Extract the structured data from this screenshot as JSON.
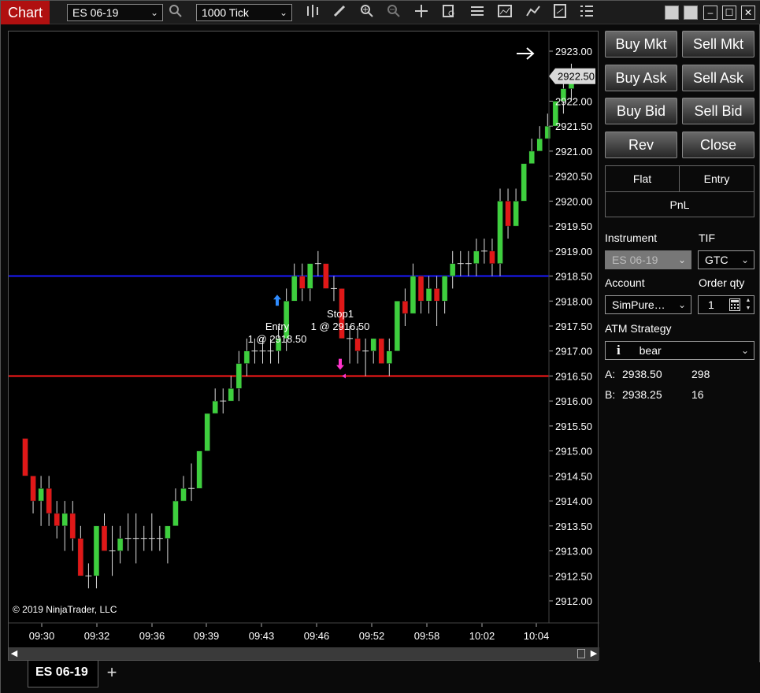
{
  "window": {
    "title": "Chart",
    "instrument_select": "ES 06-19",
    "interval_select": "1000 Tick"
  },
  "toolbar_icons": [
    "bar-type-icon",
    "pencil-icon",
    "zoom-in-icon",
    "zoom-out-icon",
    "crosshair-icon",
    "data-box-icon",
    "properties-icon",
    "indicators-icon",
    "strategies-icon",
    "templates-icon",
    "menu-icon"
  ],
  "chart": {
    "copyright": "© 2019 NinjaTrader, LLC",
    "current_price": "2922.50",
    "price_axis": [
      "2923.00",
      "2922.50",
      "2922.00",
      "2921.50",
      "2921.00",
      "2920.50",
      "2920.00",
      "2919.50",
      "2919.00",
      "2918.50",
      "2918.00",
      "2917.50",
      "2917.00",
      "2916.50",
      "2916.00",
      "2915.50",
      "2915.00",
      "2914.50",
      "2914.00",
      "2913.50",
      "2913.00",
      "2912.50",
      "2912.00"
    ],
    "time_axis": [
      "09:30",
      "09:32",
      "09:36",
      "09:39",
      "09:43",
      "09:46",
      "09:52",
      "09:58",
      "10:02",
      "10:04"
    ],
    "lines": {
      "blue": 2918.5,
      "red": 2916.5
    },
    "entry_label": "Entry",
    "entry_detail": "1 @ 2918.50",
    "stop_label": "Stop1",
    "stop_detail": "1 @ 2916.50",
    "colors": {
      "up": "#3ecf3e",
      "down": "#e01818",
      "blue_line": "#1a1aff",
      "red_line": "#ff1a1a"
    }
  },
  "chart_data": {
    "type": "candlestick",
    "ylim": [
      2911.75,
      2923.25
    ],
    "candles": [
      {
        "o": 2915.25,
        "c": 2914.5,
        "h": 2915.25,
        "l": 2914.5
      },
      {
        "o": 2914.5,
        "c": 2914.0,
        "h": 2914.5,
        "l": 2913.75
      },
      {
        "o": 2914.0,
        "c": 2914.25,
        "h": 2914.5,
        "l": 2913.5
      },
      {
        "o": 2914.25,
        "c": 2913.75,
        "h": 2914.5,
        "l": 2913.5
      },
      {
        "o": 2913.75,
        "c": 2913.5,
        "h": 2914.0,
        "l": 2913.25
      },
      {
        "o": 2913.5,
        "c": 2913.75,
        "h": 2914.0,
        "l": 2913.0
      },
      {
        "o": 2913.75,
        "c": 2913.25,
        "h": 2914.0,
        "l": 2913.0
      },
      {
        "o": 2913.25,
        "c": 2912.5,
        "h": 2913.5,
        "l": 2912.5
      },
      {
        "o": 2912.5,
        "c": 2912.5,
        "h": 2912.75,
        "l": 2912.25
      },
      {
        "o": 2912.5,
        "c": 2913.5,
        "h": 2913.5,
        "l": 2912.25
      },
      {
        "o": 2913.5,
        "c": 2913.0,
        "h": 2913.75,
        "l": 2913.0
      },
      {
        "o": 2913.0,
        "c": 2913.0,
        "h": 2913.5,
        "l": 2912.5
      },
      {
        "o": 2913.0,
        "c": 2913.25,
        "h": 2913.5,
        "l": 2912.75
      },
      {
        "o": 2913.25,
        "c": 2913.25,
        "h": 2913.75,
        "l": 2913.0
      },
      {
        "o": 2913.25,
        "c": 2913.25,
        "h": 2913.75,
        "l": 2912.75
      },
      {
        "o": 2913.25,
        "c": 2913.25,
        "h": 2913.5,
        "l": 2913.0
      },
      {
        "o": 2913.25,
        "c": 2913.25,
        "h": 2913.75,
        "l": 2913.0
      },
      {
        "o": 2913.25,
        "c": 2913.25,
        "h": 2913.5,
        "l": 2913.0
      },
      {
        "o": 2913.25,
        "c": 2913.5,
        "h": 2913.5,
        "l": 2912.75
      },
      {
        "o": 2913.5,
        "c": 2914.0,
        "h": 2914.25,
        "l": 2913.5
      },
      {
        "o": 2914.0,
        "c": 2914.25,
        "h": 2914.5,
        "l": 2914.0
      },
      {
        "o": 2914.25,
        "c": 2914.25,
        "h": 2914.75,
        "l": 2914.0
      },
      {
        "o": 2914.25,
        "c": 2915.0,
        "h": 2915.0,
        "l": 2914.25
      },
      {
        "o": 2915.0,
        "c": 2915.75,
        "h": 2915.75,
        "l": 2915.0
      },
      {
        "o": 2915.75,
        "c": 2916.0,
        "h": 2916.25,
        "l": 2915.75
      },
      {
        "o": 2916.0,
        "c": 2916.0,
        "h": 2916.25,
        "l": 2915.75
      },
      {
        "o": 2916.0,
        "c": 2916.25,
        "h": 2916.5,
        "l": 2916.0
      },
      {
        "o": 2916.25,
        "c": 2916.75,
        "h": 2917.0,
        "l": 2916.0
      },
      {
        "o": 2916.75,
        "c": 2917.0,
        "h": 2917.25,
        "l": 2916.5
      },
      {
        "o": 2917.0,
        "c": 2917.0,
        "h": 2917.25,
        "l": 2916.75
      },
      {
        "o": 2917.0,
        "c": 2917.0,
        "h": 2917.25,
        "l": 2916.75
      },
      {
        "o": 2917.0,
        "c": 2917.0,
        "h": 2917.25,
        "l": 2916.75
      },
      {
        "o": 2917.0,
        "c": 2917.25,
        "h": 2917.5,
        "l": 2916.75
      },
      {
        "o": 2917.25,
        "c": 2918.0,
        "h": 2918.25,
        "l": 2917.0
      },
      {
        "o": 2918.0,
        "c": 2918.5,
        "h": 2918.75,
        "l": 2918.0
      },
      {
        "o": 2918.5,
        "c": 2918.25,
        "h": 2918.75,
        "l": 2918.0
      },
      {
        "o": 2918.25,
        "c": 2918.75,
        "h": 2918.75,
        "l": 2918.0
      },
      {
        "o": 2918.75,
        "c": 2918.75,
        "h": 2919.0,
        "l": 2918.5
      },
      {
        "o": 2918.75,
        "c": 2918.25,
        "h": 2918.75,
        "l": 2918.25
      },
      {
        "o": 2918.25,
        "c": 2918.25,
        "h": 2918.5,
        "l": 2918.0
      },
      {
        "o": 2918.25,
        "c": 2917.25,
        "h": 2918.25,
        "l": 2917.25
      },
      {
        "o": 2917.25,
        "c": 2917.25,
        "h": 2917.5,
        "l": 2916.75
      },
      {
        "o": 2917.25,
        "c": 2917.0,
        "h": 2917.5,
        "l": 2916.75
      },
      {
        "o": 2917.0,
        "c": 2917.0,
        "h": 2917.25,
        "l": 2916.5
      },
      {
        "o": 2917.0,
        "c": 2917.25,
        "h": 2917.25,
        "l": 2916.75
      },
      {
        "o": 2917.25,
        "c": 2916.75,
        "h": 2917.25,
        "l": 2916.75
      },
      {
        "o": 2916.75,
        "c": 2917.0,
        "h": 2917.25,
        "l": 2916.5
      },
      {
        "o": 2917.0,
        "c": 2918.0,
        "h": 2918.0,
        "l": 2917.0
      },
      {
        "o": 2918.0,
        "c": 2917.75,
        "h": 2918.25,
        "l": 2917.5
      },
      {
        "o": 2917.75,
        "c": 2918.5,
        "h": 2918.75,
        "l": 2917.75
      },
      {
        "o": 2918.5,
        "c": 2918.0,
        "h": 2918.5,
        "l": 2917.75
      },
      {
        "o": 2918.0,
        "c": 2918.25,
        "h": 2918.5,
        "l": 2917.75
      },
      {
        "o": 2918.25,
        "c": 2918.0,
        "h": 2918.5,
        "l": 2917.5
      },
      {
        "o": 2918.0,
        "c": 2918.5,
        "h": 2918.5,
        "l": 2917.75
      },
      {
        "o": 2918.5,
        "c": 2918.75,
        "h": 2919.0,
        "l": 2918.25
      },
      {
        "o": 2918.75,
        "c": 2918.75,
        "h": 2919.0,
        "l": 2918.5
      },
      {
        "o": 2918.75,
        "c": 2918.75,
        "h": 2919.0,
        "l": 2918.5
      },
      {
        "o": 2918.75,
        "c": 2919.0,
        "h": 2919.25,
        "l": 2918.5
      },
      {
        "o": 2919.0,
        "c": 2919.0,
        "h": 2919.25,
        "l": 2918.75
      },
      {
        "o": 2919.0,
        "c": 2918.75,
        "h": 2919.25,
        "l": 2918.5
      },
      {
        "o": 2918.75,
        "c": 2920.0,
        "h": 2920.25,
        "l": 2918.5
      },
      {
        "o": 2920.0,
        "c": 2919.5,
        "h": 2920.25,
        "l": 2919.25
      },
      {
        "o": 2919.5,
        "c": 2920.0,
        "h": 2920.25,
        "l": 2919.5
      },
      {
        "o": 2920.0,
        "c": 2920.75,
        "h": 2920.75,
        "l": 2920.0
      },
      {
        "o": 2920.75,
        "c": 2921.0,
        "h": 2921.25,
        "l": 2920.75
      },
      {
        "o": 2921.0,
        "c": 2921.25,
        "h": 2921.5,
        "l": 2921.0
      },
      {
        "o": 2921.25,
        "c": 2921.5,
        "h": 2921.75,
        "l": 2921.25
      },
      {
        "o": 2921.5,
        "c": 2922.0,
        "h": 2922.0,
        "l": 2921.5
      },
      {
        "o": 2922.0,
        "c": 2922.25,
        "h": 2922.5,
        "l": 2921.75
      },
      {
        "o": 2922.25,
        "c": 2922.5,
        "h": 2922.75,
        "l": 2922.0
      }
    ]
  },
  "panel": {
    "buttons": [
      {
        "name": "buy-mkt-button",
        "label": "Buy Mkt"
      },
      {
        "name": "sell-mkt-button",
        "label": "Sell Mkt"
      },
      {
        "name": "buy-ask-button",
        "label": "Buy Ask"
      },
      {
        "name": "sell-ask-button",
        "label": "Sell Ask"
      },
      {
        "name": "buy-bid-button",
        "label": "Buy Bid"
      },
      {
        "name": "sell-bid-button",
        "label": "Sell Bid"
      },
      {
        "name": "rev-button",
        "label": "Rev"
      },
      {
        "name": "close-button",
        "label": "Close"
      }
    ],
    "position": {
      "flat": "Flat",
      "entry": "Entry",
      "pnl": "PnL"
    },
    "instrument_label": "Instrument",
    "instrument_value": "ES 06-19",
    "tif_label": "TIF",
    "tif_value": "GTC",
    "account_label": "Account",
    "account_value": "SimPure…",
    "qty_label": "Order qty",
    "qty_value": "1",
    "atm_label": "ATM Strategy",
    "atm_value": "bear",
    "ask_label": "A:",
    "ask_price": "2938.50",
    "ask_size": "298",
    "bid_label": "B:",
    "bid_price": "2938.25",
    "bid_size": "16"
  },
  "tabs": {
    "active": "ES 06-19",
    "add": "+"
  }
}
